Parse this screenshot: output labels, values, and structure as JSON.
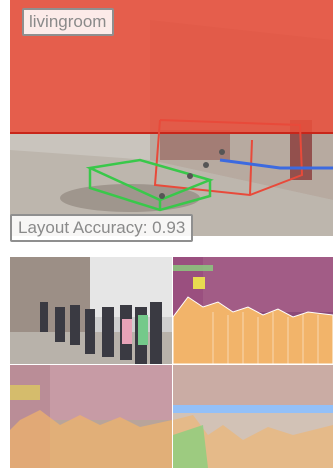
{
  "room_panel": {
    "label": "livingroom",
    "accuracy_label": "Layout Accuracy: 0.93"
  },
  "colors": {
    "overlay_red": "#e8503c",
    "box_green": "#39c84a",
    "box_red": "#e84a3a",
    "box_blue": "#3c6ae0",
    "seg_orange": "#f2b46a",
    "seg_purple": "#8c4a78",
    "seg_yellow": "#e8dc50",
    "seg_green": "#8bcf7e",
    "seg_blue": "#8cc0ff"
  },
  "street_tiles": [
    {
      "kind": "photo"
    },
    {
      "kind": "segmentation"
    },
    {
      "kind": "segmentation-overlay"
    },
    {
      "kind": "segmentation-overlay"
    }
  ]
}
